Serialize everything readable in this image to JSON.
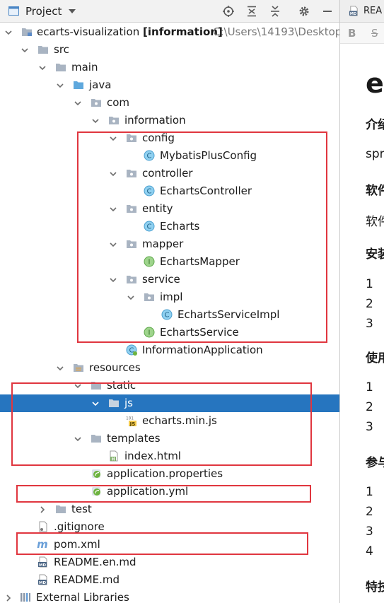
{
  "panel": {
    "title": "Project"
  },
  "colors": {
    "selection": "#2675bf",
    "highlight_box": "#e0363f",
    "class_icon": "#7fc3e8",
    "interface_icon": "#8cc97a",
    "spring_icon": "#6db33f"
  },
  "tree": {
    "root": {
      "label": "ecarts-visualization",
      "module": "[information]",
      "path": "C:\\Users\\14193\\Desktop"
    },
    "src": "src",
    "main": "main",
    "java": "java",
    "com": "com",
    "information": "information",
    "config": "config",
    "mybatis_plus_config": "MybatisPlusConfig",
    "controller": "controller",
    "echarts_controller": "EchartsController",
    "entity": "entity",
    "echarts": "Echarts",
    "mapper": "mapper",
    "echarts_mapper": "EchartsMapper",
    "service": "service",
    "impl": "impl",
    "echarts_service_impl": "EchartsServiceImpl",
    "echarts_service": "EchartsService",
    "information_application": "InformationApplication",
    "resources": "resources",
    "static": "static",
    "js": "js",
    "echarts_min_js": "echarts.min.js",
    "templates": "templates",
    "index_html": "index.html",
    "application_properties": "application.properties",
    "application_yml": "application.yml",
    "test": "test",
    "gitignore": ".gitignore",
    "pom_xml": "pom.xml",
    "readme_en": "README.en.md",
    "readme": "README.md",
    "external_libraries": "External Libraries"
  },
  "editor": {
    "tab_label": "REA",
    "toolbar": {
      "bold": "B",
      "strike": "S"
    },
    "lines": [
      {
        "style": "h1",
        "text": "ec"
      },
      {
        "style": "h2",
        "text": "介绍"
      },
      {
        "style": "p",
        "text": "spr"
      },
      {
        "style": "h2",
        "text": "软件"
      },
      {
        "style": "p",
        "text": "软件"
      },
      {
        "style": "h2",
        "text": "安装"
      },
      {
        "style": "li",
        "text": "1"
      },
      {
        "style": "li",
        "text": "2"
      },
      {
        "style": "li",
        "text": "3"
      },
      {
        "style": "h2",
        "text": "使用"
      },
      {
        "style": "li",
        "text": "1"
      },
      {
        "style": "li",
        "text": "2"
      },
      {
        "style": "li",
        "text": "3"
      },
      {
        "style": "h2",
        "text": "参与"
      },
      {
        "style": "li",
        "text": "1"
      },
      {
        "style": "li",
        "text": "2"
      },
      {
        "style": "li",
        "text": "3"
      },
      {
        "style": "li",
        "text": "4"
      },
      {
        "style": "h2",
        "text": "特技"
      }
    ]
  }
}
